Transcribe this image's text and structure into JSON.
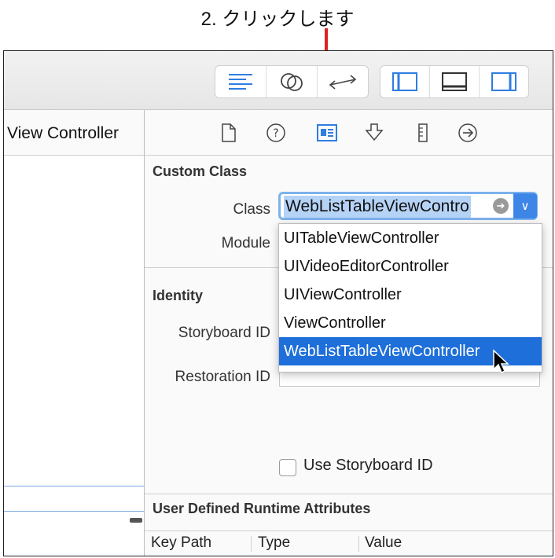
{
  "annotation": {
    "text": "2. クリックします"
  },
  "left_pane": {
    "title": "View Controller"
  },
  "toolbar": {
    "group1": [
      "align-left-icon",
      "overlap-circles-icon",
      "back-forward-arrows-icon"
    ],
    "group2": [
      "left-panel-icon",
      "bottom-panel-icon",
      "right-panel-icon"
    ]
  },
  "inspector_tabs": [
    "file-icon",
    "help-icon",
    "identity-icon",
    "attributes-icon",
    "size-ruler-icon",
    "connections-arrow-icon"
  ],
  "custom_class": {
    "title": "Custom Class",
    "class_label": "Class",
    "class_value": "WebListTableViewContro",
    "module_label": "Module",
    "options": [
      "UITableViewController",
      "UIVideoEditorController",
      "UIViewController",
      "ViewController",
      "WebListTableViewController"
    ],
    "selected_index": 4
  },
  "identity": {
    "title": "Identity",
    "storyboard_id_label": "Storyboard ID",
    "restoration_id_label": "Restoration ID",
    "use_storyboard_id_label": "Use Storyboard ID",
    "use_storyboard_id_checked": false
  },
  "runtime_attributes": {
    "title": "User Defined Runtime Attributes",
    "columns": [
      "Key Path",
      "Type",
      "Value"
    ]
  },
  "colors": {
    "accent": "#1e6fd9",
    "annotation": "#e02020",
    "selection": "#b5d3f6"
  }
}
